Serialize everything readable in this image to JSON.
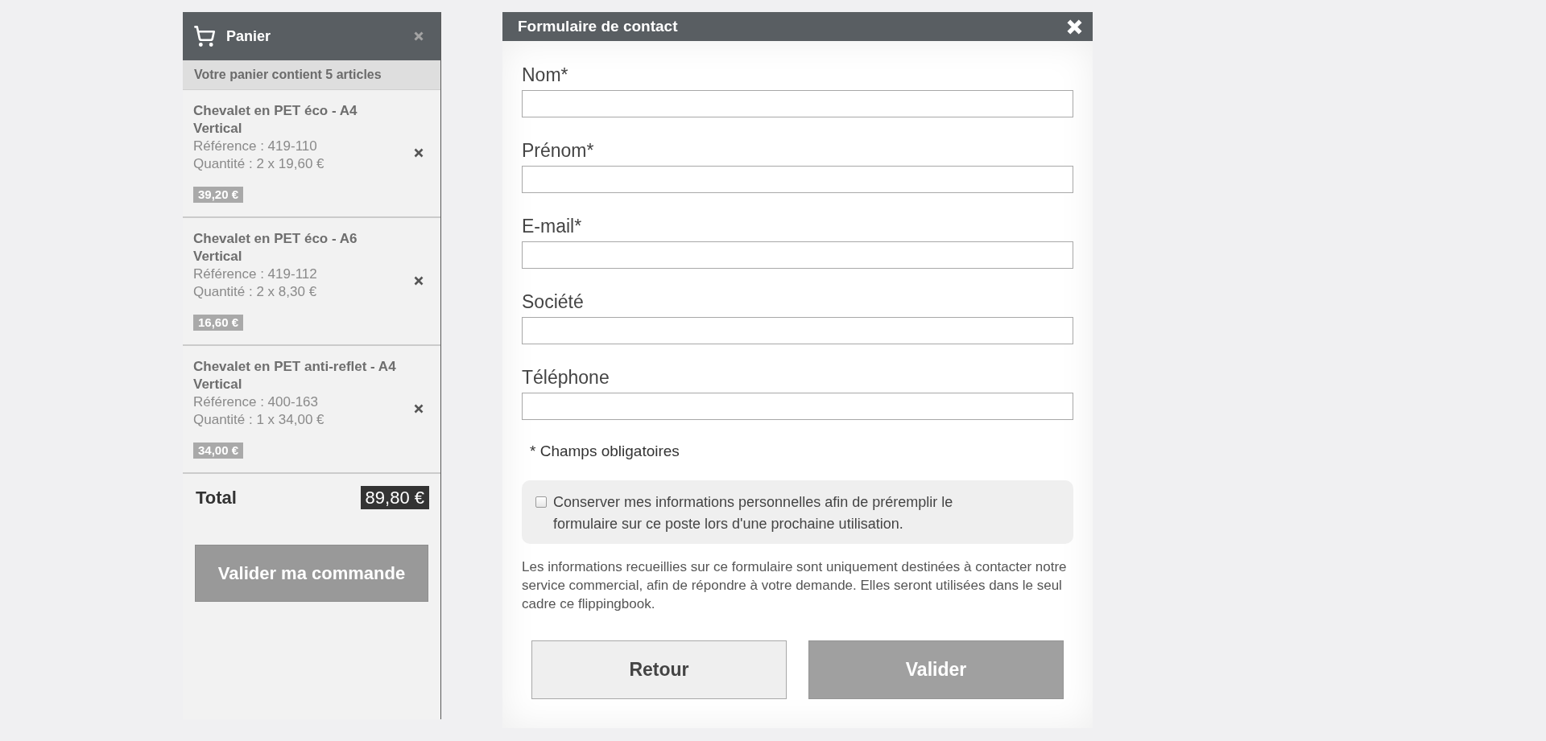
{
  "cart": {
    "title": "Panier",
    "summary": "Votre panier contient 5 articles",
    "items": [
      {
        "name": "Chevalet en PET éco - A4 Vertical",
        "reference": "Référence : 419-110",
        "quantity": "Quantité : 2 x 19,60 €",
        "price": "39,20 €"
      },
      {
        "name": "Chevalet en PET éco - A6 Vertical",
        "reference": "Référence : 419-112",
        "quantity": "Quantité : 2 x 8,30 €",
        "price": "16,60 €"
      },
      {
        "name": "Chevalet en PET anti-reflet - A4 Vertical",
        "reference": "Référence : 400-163",
        "quantity": "Quantité : 1 x 34,00 €",
        "price": "34,00 €"
      }
    ],
    "total_label": "Total",
    "total": "89,80 €",
    "checkout_button": "Valider ma commande"
  },
  "contact_form": {
    "title": "Formulaire de contact",
    "fields": [
      {
        "label": "Nom*"
      },
      {
        "label": "Prénom*"
      },
      {
        "label": "E-mail*"
      },
      {
        "label": "Société"
      },
      {
        "label": "Téléphone"
      }
    ],
    "required_note": "* Champs obligatoires",
    "remember": {
      "checked": false,
      "label": "Conserver mes informations personnelles afin de préremplir le formulaire sur ce poste lors d'une prochaine utilisation."
    },
    "disclaimer": "Les informations recueillies sur ce formulaire sont uniquement destinées à contacter notre service commercial, afin de répondre à votre demande. Elles seront utilisées dans le seul cadre ce flippingbook.",
    "buttons": [
      {
        "label": "Retour",
        "kind": "secondary"
      },
      {
        "label": "Valider",
        "kind": "primary"
      }
    ]
  }
}
